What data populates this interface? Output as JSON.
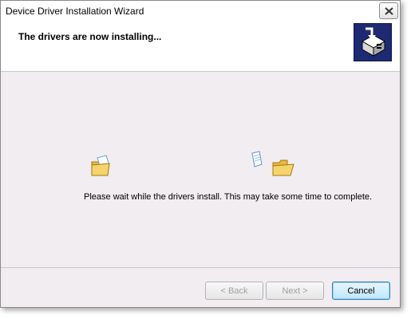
{
  "window": {
    "title": "Device Driver Installation Wizard"
  },
  "header": {
    "title": "The drivers are now installing...",
    "icon": "driver-installer-icon"
  },
  "content": {
    "status": "Please wait while the drivers install. This may take some time to complete.",
    "animation_icons": [
      "source-folder-icon",
      "flying-document-icon",
      "destination-folder-icon"
    ]
  },
  "buttons": {
    "back": "< Back",
    "next": "Next >",
    "cancel": "Cancel"
  },
  "colors": {
    "accent": "#1d2a73",
    "window_bg": "#f1edf1",
    "folder": "#f3cf5a"
  }
}
